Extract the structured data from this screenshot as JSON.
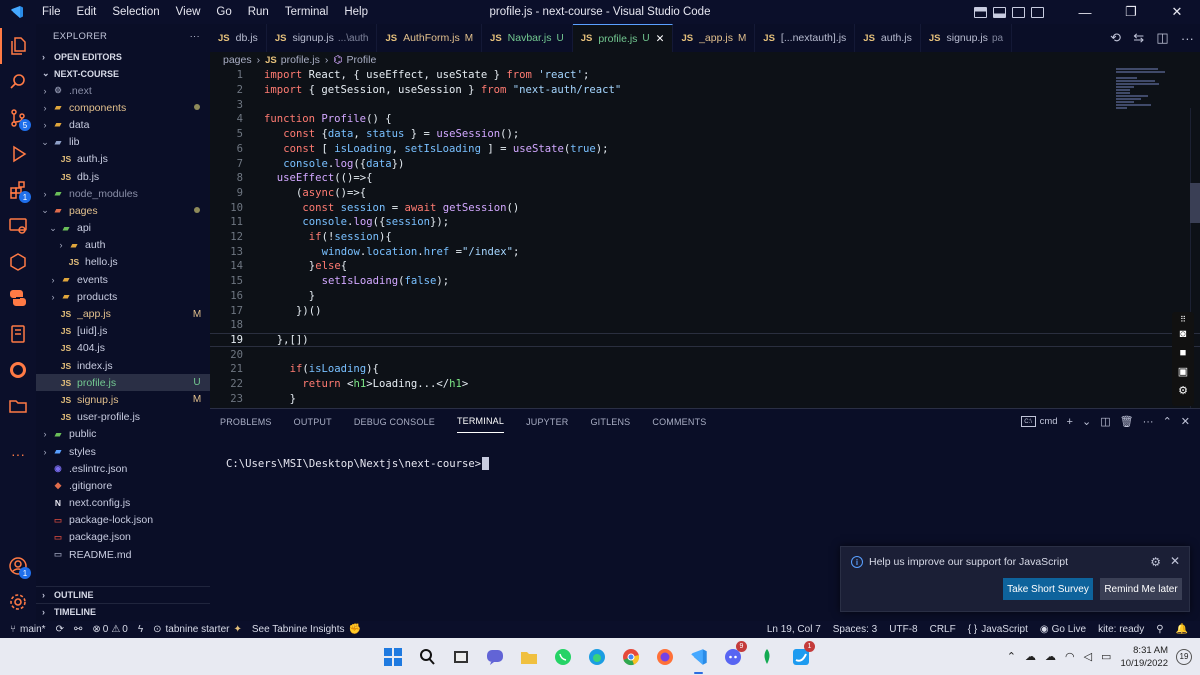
{
  "titlebar": {
    "menu": [
      "File",
      "Edit",
      "Selection",
      "View",
      "Go",
      "Run",
      "Terminal",
      "Help"
    ],
    "title": "profile.js - next-course - Visual Studio Code",
    "minimize": "—",
    "restore": "❐",
    "close": "✕"
  },
  "activity": {
    "source_control_badge": "5",
    "extensions_badge": "1",
    "accounts_badge": "1"
  },
  "sidebar": {
    "title": "EXPLORER",
    "more": "···",
    "open_editors": "OPEN EDITORS",
    "project": "NEXT-COURSE",
    "outline": "OUTLINE",
    "timeline": "TIMELINE",
    "tree": [
      {
        "name": ".next",
        "indent": 1,
        "chev": "›",
        "icon": "⚙",
        "icon_color": "#8a8fa8",
        "name_color": "#8a8fa8",
        "deco": ""
      },
      {
        "name": "components",
        "indent": 1,
        "chev": "›",
        "icon": "▰",
        "icon_color": "#e0a63c",
        "name_color": "#e2c08d",
        "deco": "dot"
      },
      {
        "name": "data",
        "indent": 1,
        "chev": "›",
        "icon": "▰",
        "icon_color": "#e0a63c",
        "name_color": "#c8cce0",
        "deco": ""
      },
      {
        "name": "lib",
        "indent": 1,
        "chev": "⌄",
        "icon": "▰",
        "icon_color": "#8fa0c8",
        "name_color": "#c8cce0",
        "deco": ""
      },
      {
        "name": "auth.js",
        "indent": 2,
        "chev": "",
        "icon": "JS",
        "icon_color": "#e5c07b",
        "name_color": "#c8cce0",
        "deco": ""
      },
      {
        "name": "db.js",
        "indent": 2,
        "chev": "",
        "icon": "JS",
        "icon_color": "#e5c07b",
        "name_color": "#c8cce0",
        "deco": ""
      },
      {
        "name": "node_modules",
        "indent": 1,
        "chev": "›",
        "icon": "▰",
        "icon_color": "#6bbf59",
        "name_color": "#8a8fa8",
        "deco": ""
      },
      {
        "name": "pages",
        "indent": 1,
        "chev": "⌄",
        "icon": "▰",
        "icon_color": "#e06c4c",
        "name_color": "#e2c08d",
        "deco": "dot"
      },
      {
        "name": "api",
        "indent": 2,
        "chev": "⌄",
        "icon": "▰",
        "icon_color": "#6bbf59",
        "name_color": "#c8cce0",
        "deco": ""
      },
      {
        "name": "auth",
        "indent": 3,
        "chev": "›",
        "icon": "▰",
        "icon_color": "#e0a63c",
        "name_color": "#c8cce0",
        "deco": ""
      },
      {
        "name": "hello.js",
        "indent": 3,
        "chev": "",
        "icon": "JS",
        "icon_color": "#e5c07b",
        "name_color": "#c8cce0",
        "deco": ""
      },
      {
        "name": "events",
        "indent": 2,
        "chev": "›",
        "icon": "▰",
        "icon_color": "#e0a63c",
        "name_color": "#c8cce0",
        "deco": ""
      },
      {
        "name": "products",
        "indent": 2,
        "chev": "›",
        "icon": "▰",
        "icon_color": "#e0a63c",
        "name_color": "#c8cce0",
        "deco": ""
      },
      {
        "name": "_app.js",
        "indent": 2,
        "chev": "",
        "icon": "JS",
        "icon_color": "#e5c07b",
        "name_color": "#e2c08d",
        "deco": "M"
      },
      {
        "name": "[uid].js",
        "indent": 2,
        "chev": "",
        "icon": "JS",
        "icon_color": "#e5c07b",
        "name_color": "#c8cce0",
        "deco": ""
      },
      {
        "name": "404.js",
        "indent": 2,
        "chev": "",
        "icon": "JS",
        "icon_color": "#e5c07b",
        "name_color": "#c8cce0",
        "deco": ""
      },
      {
        "name": "index.js",
        "indent": 2,
        "chev": "",
        "icon": "JS",
        "icon_color": "#e5c07b",
        "name_color": "#c8cce0",
        "deco": ""
      },
      {
        "name": "profile.js",
        "indent": 2,
        "chev": "",
        "icon": "JS",
        "icon_color": "#e5c07b",
        "name_color": "#73c991",
        "deco": "U",
        "selected": true
      },
      {
        "name": "signup.js",
        "indent": 2,
        "chev": "",
        "icon": "JS",
        "icon_color": "#e5c07b",
        "name_color": "#e2c08d",
        "deco": "M"
      },
      {
        "name": "user-profile.js",
        "indent": 2,
        "chev": "",
        "icon": "JS",
        "icon_color": "#e5c07b",
        "name_color": "#c8cce0",
        "deco": ""
      },
      {
        "name": "public",
        "indent": 1,
        "chev": "›",
        "icon": "▰",
        "icon_color": "#6bbf59",
        "name_color": "#c8cce0",
        "deco": ""
      },
      {
        "name": "styles",
        "indent": 1,
        "chev": "›",
        "icon": "▰",
        "icon_color": "#5aa0ff",
        "name_color": "#c8cce0",
        "deco": ""
      },
      {
        "name": ".eslintrc.json",
        "indent": 1,
        "chev": "",
        "icon": "◉",
        "icon_color": "#7a6cf0",
        "name_color": "#c8cce0",
        "deco": ""
      },
      {
        "name": ".gitignore",
        "indent": 1,
        "chev": "",
        "icon": "◆",
        "icon_color": "#e06c4c",
        "name_color": "#c8cce0",
        "deco": ""
      },
      {
        "name": "next.config.js",
        "indent": 1,
        "chev": "",
        "icon": "N",
        "icon_color": "#e6e6f0",
        "name_color": "#c8cce0",
        "deco": ""
      },
      {
        "name": "package-lock.json",
        "indent": 1,
        "chev": "",
        "icon": "▭",
        "icon_color": "#c4453c",
        "name_color": "#c8cce0",
        "deco": ""
      },
      {
        "name": "package.json",
        "indent": 1,
        "chev": "",
        "icon": "▭",
        "icon_color": "#c4453c",
        "name_color": "#c8cce0",
        "deco": ""
      },
      {
        "name": "README.md",
        "indent": 1,
        "chev": "",
        "icon": "▭",
        "icon_color": "#8a8fa8",
        "name_color": "#c8cce0",
        "deco": ""
      }
    ]
  },
  "tabs": [
    {
      "label": "db.js",
      "desc": "",
      "status": "",
      "status_color": ""
    },
    {
      "label": "signup.js",
      "desc": "...\\auth",
      "status": "",
      "status_color": ""
    },
    {
      "label": "AuthForm.js",
      "desc": "",
      "status": "M",
      "status_color": "#e2c08d"
    },
    {
      "label": "Navbar.js",
      "desc": "",
      "status": "U",
      "status_color": "#73c991"
    },
    {
      "label": "profile.js",
      "desc": "",
      "status": "U",
      "status_color": "#73c991",
      "active": true
    },
    {
      "label": "_app.js",
      "desc": "",
      "status": "M",
      "status_color": "#e2c08d"
    },
    {
      "label": "[...nextauth].js",
      "desc": "",
      "status": "",
      "status_color": ""
    },
    {
      "label": "auth.js",
      "desc": "",
      "status": "",
      "status_color": ""
    },
    {
      "label": "signup.js",
      "desc": "pa",
      "status": "",
      "status_color": ""
    }
  ],
  "breadcrumb": {
    "folder": "pages",
    "file": "profile.js",
    "symbol": "Profile"
  },
  "editor": {
    "current_line": 19,
    "lines": [
      {
        "n": 1,
        "indent": 0,
        "tokens": [
          [
            "kw",
            "import "
          ],
          [
            "id",
            "React, "
          ],
          [
            "pl",
            "{ "
          ],
          [
            "id",
            "useEffect, useState "
          ],
          [
            "pl",
            "} "
          ],
          [
            "kw",
            "from "
          ],
          [
            "str",
            "'react'"
          ],
          [
            "pl",
            ";"
          ]
        ]
      },
      {
        "n": 2,
        "indent": 0,
        "tokens": [
          [
            "kw",
            "import "
          ],
          [
            "pl",
            "{ "
          ],
          [
            "id",
            "getSession, useSession "
          ],
          [
            "pl",
            "} "
          ],
          [
            "kw",
            "from "
          ],
          [
            "str",
            "\"next-auth/react\""
          ]
        ]
      },
      {
        "n": 3,
        "indent": 0,
        "tokens": []
      },
      {
        "n": 4,
        "indent": 0,
        "tokens": [
          [
            "kw",
            "function "
          ],
          [
            "fn",
            "Profile"
          ],
          [
            "pl",
            "() {"
          ]
        ]
      },
      {
        "n": 5,
        "indent": 3,
        "tokens": [
          [
            "kw",
            "const "
          ],
          [
            "pl",
            "{"
          ],
          [
            "var",
            "data"
          ],
          [
            "pl",
            ", "
          ],
          [
            "var",
            "status "
          ],
          [
            "pl",
            "} = "
          ],
          [
            "fn",
            "useSession"
          ],
          [
            "pl",
            "();"
          ]
        ]
      },
      {
        "n": 6,
        "indent": 3,
        "tokens": [
          [
            "kw",
            "const "
          ],
          [
            "pl",
            "[ "
          ],
          [
            "var",
            "isLoading"
          ],
          [
            "pl",
            ", "
          ],
          [
            "var",
            "setIsLoading "
          ],
          [
            "pl",
            "] = "
          ],
          [
            "fn",
            "useState"
          ],
          [
            "pl",
            "("
          ],
          [
            "lit",
            "true"
          ],
          [
            "pl",
            ");"
          ]
        ]
      },
      {
        "n": 7,
        "indent": 3,
        "tokens": [
          [
            "var",
            "console"
          ],
          [
            "pl",
            "."
          ],
          [
            "fn",
            "log"
          ],
          [
            "pl",
            "({"
          ],
          [
            "var",
            "data"
          ],
          [
            "pl",
            "})"
          ]
        ]
      },
      {
        "n": 8,
        "indent": 2,
        "tokens": [
          [
            "fn",
            "useEffect"
          ],
          [
            "pl",
            "(()=>{"
          ]
        ]
      },
      {
        "n": 9,
        "indent": 5,
        "tokens": [
          [
            "pl",
            "("
          ],
          [
            "kw",
            "async"
          ],
          [
            "pl",
            "()=>{"
          ]
        ]
      },
      {
        "n": 10,
        "indent": 6,
        "tokens": [
          [
            "kw",
            "const "
          ],
          [
            "var",
            "session "
          ],
          [
            "pl",
            "= "
          ],
          [
            "kw",
            "await "
          ],
          [
            "fn",
            "getSession"
          ],
          [
            "pl",
            "()"
          ]
        ]
      },
      {
        "n": 11,
        "indent": 6,
        "tokens": [
          [
            "var",
            "console"
          ],
          [
            "pl",
            "."
          ],
          [
            "fn",
            "log"
          ],
          [
            "pl",
            "({"
          ],
          [
            "var",
            "session"
          ],
          [
            "pl",
            "});"
          ]
        ]
      },
      {
        "n": 12,
        "indent": 7,
        "tokens": [
          [
            "kw",
            "if"
          ],
          [
            "pl",
            "(!"
          ],
          [
            "var",
            "session"
          ],
          [
            "pl",
            "){"
          ]
        ]
      },
      {
        "n": 13,
        "indent": 9,
        "tokens": [
          [
            "var",
            "window"
          ],
          [
            "pl",
            "."
          ],
          [
            "var",
            "location"
          ],
          [
            "pl",
            "."
          ],
          [
            "var",
            "href "
          ],
          [
            "pl",
            "="
          ],
          [
            "str",
            "\"/index\""
          ],
          [
            "pl",
            ";"
          ]
        ]
      },
      {
        "n": 14,
        "indent": 7,
        "tokens": [
          [
            "pl",
            "}"
          ],
          [
            "kw",
            "else"
          ],
          [
            "pl",
            "{"
          ]
        ]
      },
      {
        "n": 15,
        "indent": 9,
        "tokens": [
          [
            "fn",
            "setIsLoading"
          ],
          [
            "pl",
            "("
          ],
          [
            "lit",
            "false"
          ],
          [
            "pl",
            ");"
          ]
        ]
      },
      {
        "n": 16,
        "indent": 7,
        "tokens": [
          [
            "pl",
            "}"
          ]
        ]
      },
      {
        "n": 17,
        "indent": 5,
        "tokens": [
          [
            "pl",
            "})()"
          ]
        ]
      },
      {
        "n": 18,
        "indent": 0,
        "tokens": []
      },
      {
        "n": 19,
        "indent": 2,
        "tokens": [
          [
            "pl",
            "},[])"
          ]
        ]
      },
      {
        "n": 20,
        "indent": 0,
        "tokens": []
      },
      {
        "n": 21,
        "indent": 4,
        "tokens": [
          [
            "kw",
            "if"
          ],
          [
            "pl",
            "("
          ],
          [
            "var",
            "isLoading"
          ],
          [
            "pl",
            "){"
          ]
        ]
      },
      {
        "n": 22,
        "indent": 6,
        "tokens": [
          [
            "kw",
            "return "
          ],
          [
            "pl",
            "<"
          ],
          [
            "tag",
            "h1"
          ],
          [
            "pl",
            ">Loading...</"
          ],
          [
            "tag",
            "h1"
          ],
          [
            "pl",
            ">"
          ]
        ]
      },
      {
        "n": 23,
        "indent": 4,
        "tokens": [
          [
            "pl",
            "}"
          ]
        ]
      }
    ]
  },
  "panel": {
    "tabs": [
      "PROBLEMS",
      "OUTPUT",
      "DEBUG CONSOLE",
      "TERMINAL",
      "JUPYTER",
      "GITLENS",
      "COMMENTS"
    ],
    "active_tab": "TERMINAL",
    "terminal_kind": "cmd",
    "prompt": "C:\\Users\\MSI\\Desktop\\Nextjs\\next-course>"
  },
  "notification": {
    "message": "Help us improve our support for JavaScript",
    "primary": "Take Short Survey",
    "secondary": "Remind Me later"
  },
  "statusbar": {
    "branch": "main*",
    "errors": "0",
    "warnings": "0",
    "tabnine": "tabnine starter",
    "insights": "See Tabnine Insights",
    "position": "Ln 19, Col 7",
    "spaces": "Spaces: 3",
    "encoding": "UTF-8",
    "eol": "CRLF",
    "language": "JavaScript",
    "golive": "Go Live",
    "kite": "kite: ready"
  },
  "taskbar": {
    "discord_badge": "9",
    "twitter_badge": "1",
    "time": "8:31 AM",
    "date": "10/19/2022",
    "notifications": "19"
  }
}
